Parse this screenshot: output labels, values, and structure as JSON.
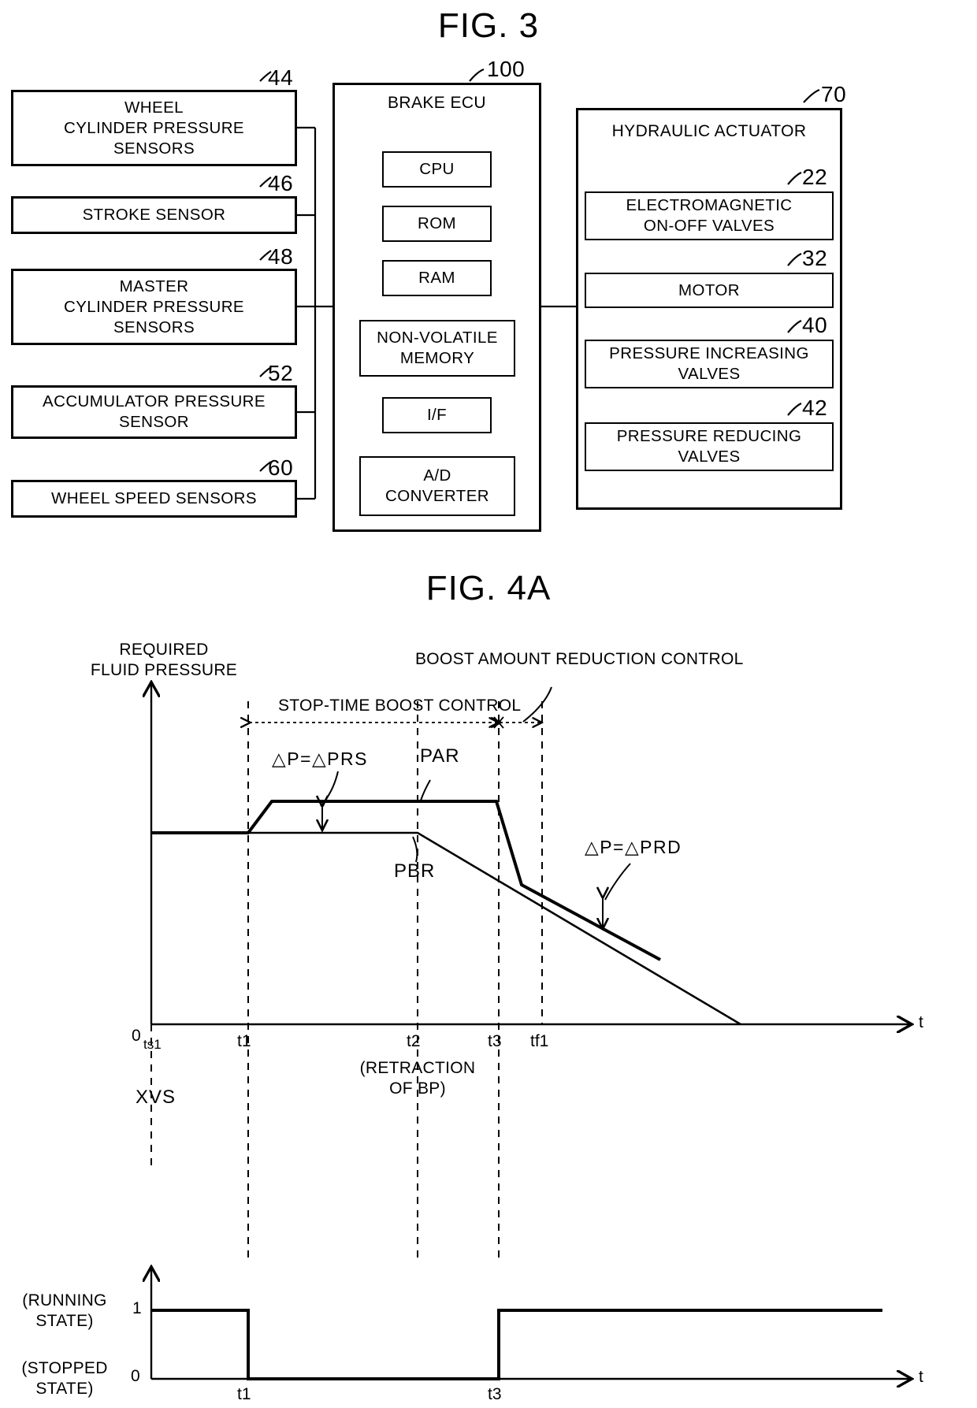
{
  "figures": {
    "fig3": {
      "title": "FIG. 3",
      "sensors": [
        {
          "ref": "44",
          "label": "WHEEL\nCYLINDER PRESSURE\nSENSORS"
        },
        {
          "ref": "46",
          "label": "STROKE SENSOR"
        },
        {
          "ref": "48",
          "label": "MASTER\nCYLINDER PRESSURE\nSENSORS"
        },
        {
          "ref": "52",
          "label": "ACCUMULATOR PRESSURE\nSENSOR"
        },
        {
          "ref": "60",
          "label": "WHEEL SPEED SENSORS"
        }
      ],
      "ecu": {
        "ref": "100",
        "title": "BRAKE ECU",
        "modules": [
          {
            "label": "CPU"
          },
          {
            "label": "ROM"
          },
          {
            "label": "RAM"
          },
          {
            "label": "NON-VOLATILE\nMEMORY"
          },
          {
            "label": "I/F"
          },
          {
            "label": "A/D\nCONVERTER"
          }
        ]
      },
      "actuator": {
        "ref": "70",
        "title": "HYDRAULIC ACTUATOR",
        "modules": [
          {
            "ref": "22",
            "label": "ELECTROMAGNETIC\nON-OFF VALVES"
          },
          {
            "ref": "32",
            "label": "MOTOR"
          },
          {
            "ref": "40",
            "label": "PRESSURE INCREASING\nVALVES"
          },
          {
            "ref": "42",
            "label": "PRESSURE REDUCING\nVALVES"
          }
        ]
      }
    },
    "fig4a": {
      "title": "FIG. 4A",
      "upper_chart": {
        "y_axis_label": "REQUIRED\nFLUID PRESSURE",
        "x_axis_label": "t",
        "origin_label": "0",
        "annotations": [
          {
            "name": "stop-time-boost-control",
            "text": "STOP-TIME BOOST CONTROL"
          },
          {
            "name": "boost-amount-reduction-control",
            "text": "BOOST AMOUNT REDUCTION CONTROL"
          },
          {
            "name": "delta-p-prs",
            "text": "△P=△PRS"
          },
          {
            "name": "delta-p-prd",
            "text": "△P=△PRD"
          },
          {
            "name": "curve-par",
            "text": "PAR"
          },
          {
            "name": "curve-pbr",
            "text": "PBR"
          },
          {
            "name": "retraction-of-bp",
            "text": "(RETRACTION\nOF BP)"
          }
        ],
        "ticks": [
          {
            "name": "ts1",
            "label": "ts1"
          },
          {
            "name": "t1",
            "label": "t1"
          },
          {
            "name": "t2",
            "label": "t2"
          },
          {
            "name": "t3",
            "label": "t3"
          },
          {
            "name": "tf1",
            "label": "tf1"
          }
        ]
      },
      "lower_chart": {
        "y_axis_label": "XVS",
        "x_axis_label": "t",
        "level_high": "1",
        "level_low": "0",
        "state_high": "(RUNNING\nSTATE)",
        "state_low": "(STOPPED\nSTATE)",
        "ticks": [
          {
            "name": "t1",
            "label": "t1"
          },
          {
            "name": "t3",
            "label": "t3"
          }
        ]
      }
    }
  },
  "chart_data": [
    {
      "type": "line",
      "name": "required-fluid-pressure-vs-time",
      "title": "FIG. 4A",
      "xlabel": "t",
      "ylabel": "REQUIRED FLUID PRESSURE",
      "grid": false,
      "legend": "inline-labels",
      "x_ticks": [
        "ts1",
        "t1",
        "t2",
        "t3",
        "tf1"
      ],
      "x_tick_values": [
        0,
        1,
        2.75,
        3.6,
        4.25
      ],
      "xlim": [
        0,
        6.6
      ],
      "ylim": [
        0,
        4
      ],
      "series": [
        {
          "name": "PAR",
          "comment": "boosted required pressure: flat at PBR level until t1, ramps up to boosted plateau, holds until t2, then decays to zero",
          "x": [
            0,
            1.0,
            1.22,
            2.75,
            3.6,
            5.45
          ],
          "y": [
            2.05,
            2.05,
            2.5,
            2.5,
            1.28,
            0.0
          ]
        },
        {
          "name": "PBR",
          "comment": "base required pressure: flat level until t2, then decays to zero faster",
          "x": [
            0,
            2.75,
            4.25
          ],
          "y": [
            2.05,
            2.05,
            0.0
          ]
        }
      ],
      "annotations": [
        {
          "text": "STOP-TIME BOOST CONTROL",
          "span": [
            "t1",
            "t3"
          ],
          "type": "double-arrow"
        },
        {
          "text": "BOOST AMOUNT REDUCTION CONTROL",
          "span": [
            "t3",
            "tf1"
          ],
          "type": "double-arrow"
        },
        {
          "text": "△P=△PRS",
          "type": "vertical-gap",
          "at": "between t1 and t2",
          "between": [
            "PAR",
            "PBR"
          ]
        },
        {
          "text": "△P=△PRD",
          "type": "vertical-gap",
          "at": "near t3",
          "between": [
            "PBR",
            "PAR"
          ]
        },
        {
          "text": "(RETRACTION OF BP)",
          "at": "t2"
        }
      ]
    },
    {
      "type": "line",
      "name": "xvs-vehicle-running-state-vs-time",
      "xlabel": "t",
      "ylabel": "XVS",
      "grid": false,
      "ylim": [
        0,
        1.45
      ],
      "y_ticks": [
        "0",
        "1"
      ],
      "y_tick_labels": {
        "1": "(RUNNING STATE)",
        "0": "(STOPPED STATE)"
      },
      "x_ticks": [
        "t1",
        "t3"
      ],
      "series": [
        {
          "name": "XVS",
          "comment": "step signal: 1 (running) until t1, 0 (stopped) from t1 to t3, back to 1 after t3",
          "x": [
            0,
            1.0,
            1.0,
            3.6,
            3.6,
            6.6
          ],
          "y": [
            1,
            1,
            0,
            0,
            1,
            1
          ]
        }
      ]
    }
  ]
}
